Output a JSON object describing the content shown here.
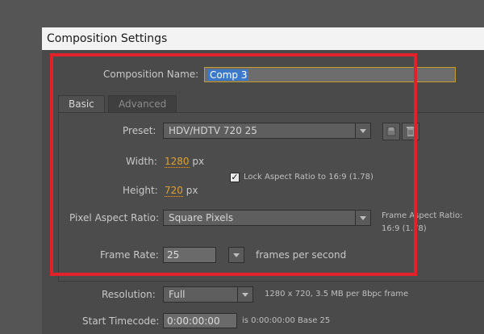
{
  "window": {
    "title": "Composition Settings"
  },
  "composition_name": {
    "label": "Composition Name:",
    "value": "Comp 3"
  },
  "tabs": [
    {
      "label": "Basic",
      "active": true
    },
    {
      "label": "Advanced",
      "active": false
    }
  ],
  "preset": {
    "label": "Preset:",
    "value": "HDV/HDTV 720 25",
    "icons": [
      "save-preset-icon",
      "trash-icon"
    ]
  },
  "width": {
    "label": "Width:",
    "value": "1280",
    "unit": "px"
  },
  "height": {
    "label": "Height:",
    "value": "720",
    "unit": "px"
  },
  "lock_aspect": {
    "label": "Lock Aspect Ratio to 16:9 (1.78)",
    "checked": true
  },
  "pixel_aspect": {
    "label": "Pixel Aspect Ratio:",
    "value": "Square Pixels",
    "info_line1": "Frame Aspect Ratio:",
    "info_line2": "16:9 (1.78)"
  },
  "frame_rate": {
    "label": "Frame Rate:",
    "value": "25",
    "unit": "frames per second"
  },
  "resolution": {
    "label": "Resolution:",
    "value": "Full",
    "info": "1280 x 720, 3.5 MB per 8bpc frame"
  },
  "start_timecode": {
    "label": "Start Timecode:",
    "value": "0:00:00:00",
    "info": "is 0:00:00:00 Base 25"
  },
  "colors": {
    "highlight": "#e2222a",
    "value_orange": "#e0a22f",
    "selection_blue": "#3d79c9"
  }
}
